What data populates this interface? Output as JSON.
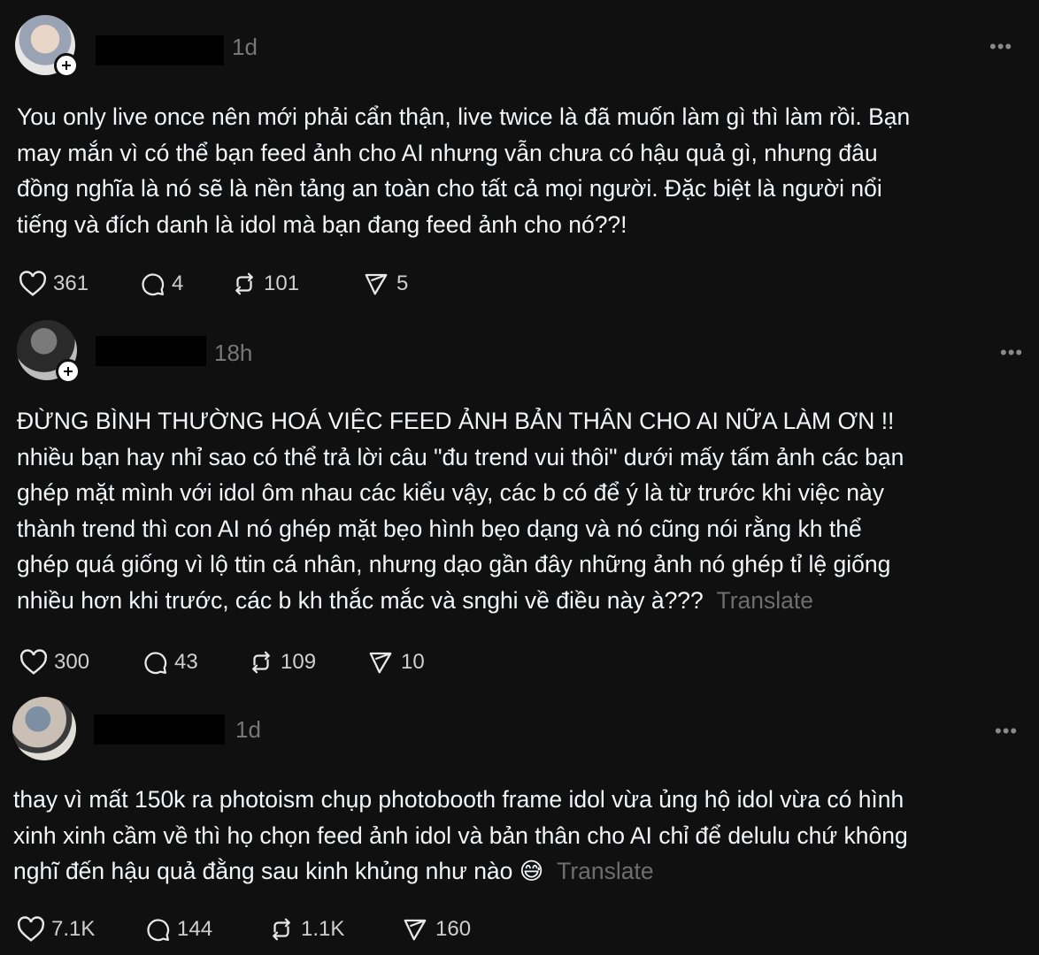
{
  "posts": [
    {
      "time": "1d",
      "lines": [
        "You only live once nên mới phải cẩn thận, live twice là đã muốn làm gì thì làm rồi. Bạn",
        "may mắn vì có thể bạn feed ảnh cho AI nhưng vẫn chưa có hậu quả gì, nhưng đâu",
        "đồng nghĩa là nó sẽ là nền tảng an toàn cho tất cả mọi người. Đặc biệt là người nổi",
        "tiếng và đích danh là idol mà bạn đang feed ảnh cho nó??!"
      ],
      "translate": "",
      "likes": "361",
      "comments": "4",
      "reposts": "101",
      "shares": "5"
    },
    {
      "time": "18h",
      "lines": [
        "ĐỪNG BÌNH THƯỜNG HOÁ VIỆC FEED ẢNH BẢN THÂN CHO AI NỮA LÀM ƠN !!",
        "nhiều bạn hay nhỉ sao có thể trả lời câu \"đu trend vui thôi\" dưới mấy tấm ảnh các bạn",
        "ghép mặt mình với idol ôm nhau các kiểu vậy, các b có để ý là từ trước khi việc này",
        "thành trend thì con AI nó ghép mặt bẹo hình bẹo dạng và nó cũng nói rằng kh thể",
        "ghép quá giống vì lộ ttin cá nhân, nhưng dạo gần đây những ảnh nó ghép tỉ lệ giống",
        "nhiều hơn khi trước, các b kh thắc mắc và snghi về điều này à???"
      ],
      "translate": "Translate",
      "likes": "300",
      "comments": "43",
      "reposts": "109",
      "shares": "10"
    },
    {
      "time": "1d",
      "lines": [
        "thay vì mất 150k ra photoism chụp photobooth frame idol vừa ủng hộ idol vừa có hình",
        "xinh xinh cầm về thì họ chọn feed ảnh idol và bản thân cho AI chỉ để delulu chứ không",
        "nghĩ đến hậu quả đằng sau kinh khủng như nào"
      ],
      "emoji": "😅",
      "translate": "Translate",
      "likes": "7.1K",
      "comments": "144",
      "reposts": "1.1K",
      "shares": "160"
    }
  ],
  "icons": {
    "like": "heart-icon",
    "comment": "comment-icon",
    "repost": "repost-icon",
    "share": "send-icon",
    "more": "more-icon",
    "follow": "plus-icon"
  },
  "colors": {
    "background": "#101010",
    "text": "#f3f5f7",
    "muted": "#777777"
  }
}
